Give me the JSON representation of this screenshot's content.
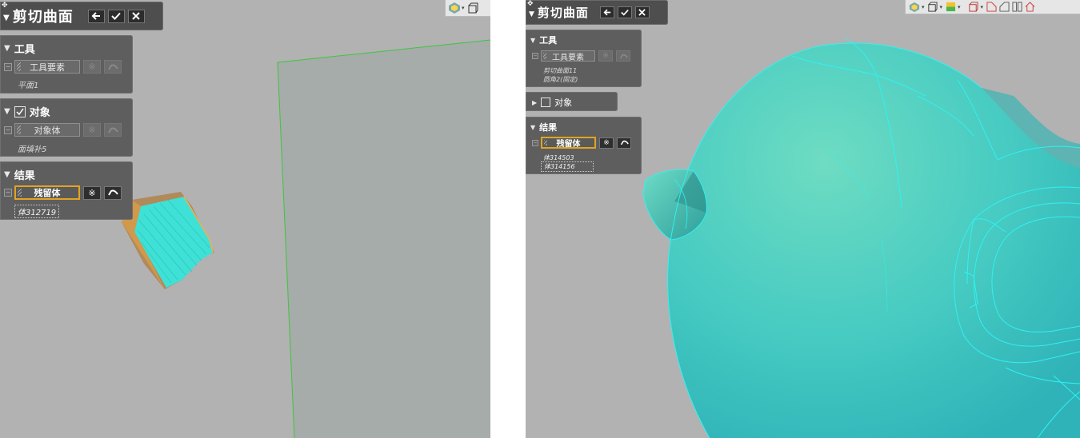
{
  "left": {
    "dialog": {
      "title": "剪切曲面",
      "back_label": "back",
      "ok_label": "ok",
      "close_label": "close"
    },
    "tool_section": {
      "heading": "工具",
      "field_label": "工具要素",
      "items": [
        "平面1"
      ]
    },
    "target_section": {
      "heading": "对象",
      "checked": true,
      "field_label": "对象体",
      "items": [
        "面填补5"
      ]
    },
    "result_section": {
      "heading": "结果",
      "field_label": "残留体",
      "items": [
        "体312719"
      ]
    }
  },
  "right": {
    "dialog": {
      "title": "剪切曲面"
    },
    "tool_section": {
      "heading": "工具",
      "field_label": "工具要素",
      "items": [
        "剪切曲面11",
        "圆角2(固定)"
      ]
    },
    "target_section": {
      "heading": "对象",
      "checked": false
    },
    "result_section": {
      "heading": "结果",
      "field_label": "残留体",
      "items": [
        "体314503",
        "体314156"
      ]
    }
  },
  "colors": {
    "viewport_bg": "#b2b2b2",
    "panel_bg": "#5e5e5e",
    "title_bg": "#4e4e4e",
    "active_field_border": "#e2a420",
    "surface_cyan": "#40c9c2",
    "edge_cyan": "#2ef2f2",
    "plane_edge_green": "#3fc43f"
  },
  "icons": [
    "pin-icon",
    "back-arrow-icon",
    "check-icon",
    "close-icon",
    "select-all-icon",
    "undo-icon",
    "view-orientation-icon",
    "box-view-icon",
    "color-view-icon",
    "section-view-icon"
  ]
}
